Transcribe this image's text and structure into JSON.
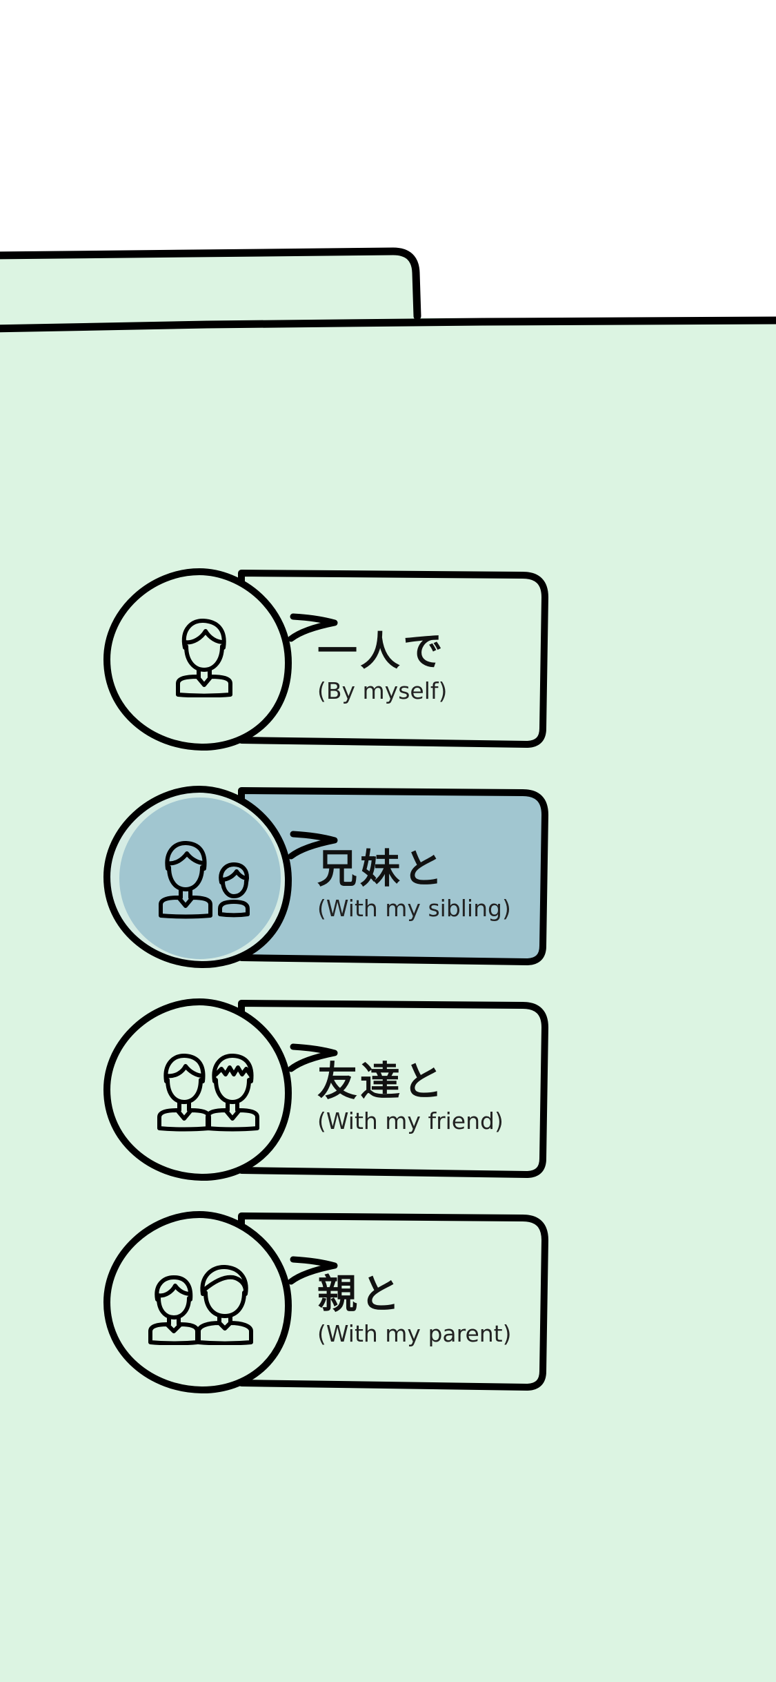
{
  "screen": {
    "background": "#ffffff",
    "folder_color": "#dcf4e2",
    "outline_color": "#000000",
    "selected_color": "#a1c6d0",
    "selected_ring_color": "#d5ece4"
  },
  "options": [
    {
      "label_jp": "一人で",
      "label_en": "(By myself)",
      "icon": "single-person-icon",
      "selected": false
    },
    {
      "label_jp": "兄妹と",
      "label_en": "(With my sibling)",
      "icon": "siblings-icon",
      "selected": true
    },
    {
      "label_jp": "友達と",
      "label_en": "(With my friend)",
      "icon": "friends-icon",
      "selected": false
    },
    {
      "label_jp": "親と",
      "label_en": "(With my parent)",
      "icon": "parent-child-icon",
      "selected": false
    }
  ]
}
